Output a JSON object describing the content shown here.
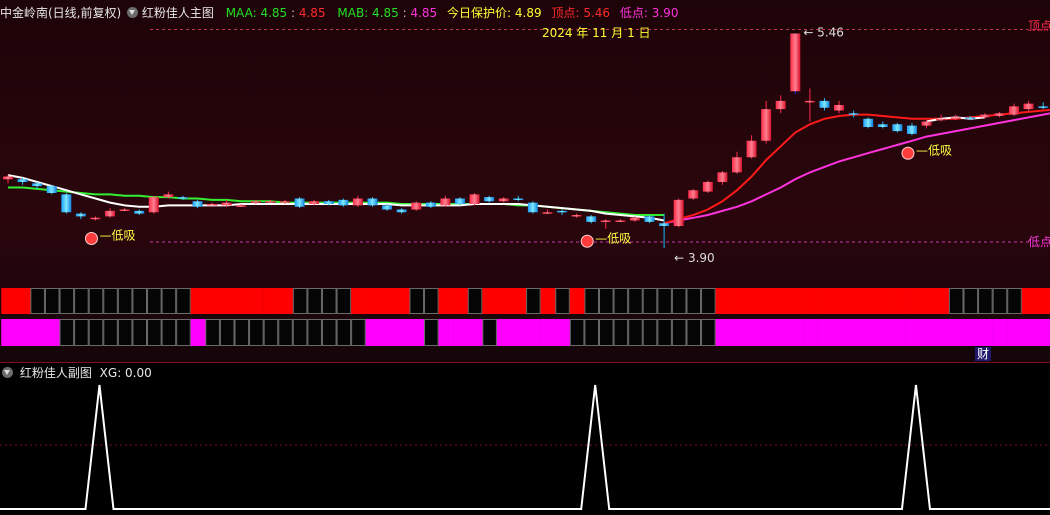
{
  "header": {
    "stock_name": "中金岭南(日线,前复权)",
    "indicator_name": "红粉佳人主图",
    "maa_label": "MAA: 4.85",
    "maa_value": "4.85",
    "mab_label": "MAB: 4.85",
    "mab_value": "4.85",
    "protect_label": "今日保护价:",
    "protect_value": "4.89",
    "top_label": "顶点:",
    "top_value": "5.46",
    "low_label": "低点:",
    "low_value": "3.90"
  },
  "date_label": "2024 年 11 月 1 日",
  "annotations": {
    "high_price": "5.46",
    "low_price": "3.90",
    "low_buy": "低吸",
    "right_low_tag": "低点",
    "right_top_tag": "顶点",
    "cai_tag": "财"
  },
  "sub_panel": {
    "title": "红粉佳人副图",
    "xg_label": "XG: 0.00"
  },
  "colors": {
    "up": "#ff2a4a",
    "down": "#17b8ff",
    "maa": "#ff1a1a",
    "mab": "#ff33dd",
    "ma_white": "#ffffff",
    "ma_green": "#33ee33",
    "band_red": "#ff0000",
    "band_magenta": "#ff00ff"
  },
  "chart_data": {
    "type": "candlestick",
    "price_range": [
      3.74,
      5.5
    ],
    "top_price": 5.46,
    "low_price": 3.9,
    "candles": [
      [
        4.4,
        4.42,
        4.37,
        4.43
      ],
      [
        4.4,
        4.38,
        4.36,
        4.41
      ],
      [
        4.37,
        4.35,
        4.33,
        4.38
      ],
      [
        4.35,
        4.3,
        4.29,
        4.36
      ],
      [
        4.29,
        4.16,
        4.15,
        4.3
      ],
      [
        4.15,
        4.13,
        4.11,
        4.16
      ],
      [
        4.12,
        4.12,
        4.1,
        4.13
      ],
      [
        4.13,
        4.17,
        4.12,
        4.19
      ],
      [
        4.18,
        4.18,
        4.17,
        4.19
      ],
      [
        4.17,
        4.15,
        4.14,
        4.18
      ],
      [
        4.16,
        4.27,
        4.15,
        4.28
      ],
      [
        4.27,
        4.29,
        4.26,
        4.31
      ],
      [
        4.27,
        4.26,
        4.25,
        4.28
      ],
      [
        4.24,
        4.2,
        4.19,
        4.25
      ],
      [
        4.22,
        4.22,
        4.21,
        4.23
      ],
      [
        4.21,
        4.23,
        4.2,
        4.25
      ],
      [
        4.21,
        4.21,
        4.2,
        4.22
      ],
      [
        4.23,
        4.24,
        4.22,
        4.25
      ],
      [
        4.24,
        4.24,
        4.23,
        4.25
      ],
      [
        4.23,
        4.24,
        4.22,
        4.25
      ],
      [
        4.26,
        4.2,
        4.19,
        4.27
      ],
      [
        4.22,
        4.24,
        4.21,
        4.25
      ],
      [
        4.24,
        4.22,
        4.21,
        4.25
      ],
      [
        4.25,
        4.21,
        4.2,
        4.26
      ],
      [
        4.21,
        4.26,
        4.2,
        4.28
      ],
      [
        4.26,
        4.21,
        4.2,
        4.27
      ],
      [
        4.21,
        4.18,
        4.17,
        4.22
      ],
      [
        4.18,
        4.16,
        4.15,
        4.19
      ],
      [
        4.18,
        4.23,
        4.17,
        4.24
      ],
      [
        4.23,
        4.2,
        4.19,
        4.24
      ],
      [
        4.21,
        4.26,
        4.2,
        4.28
      ],
      [
        4.26,
        4.22,
        4.21,
        4.27
      ],
      [
        4.22,
        4.29,
        4.21,
        4.3
      ],
      [
        4.27,
        4.24,
        4.23,
        4.28
      ],
      [
        4.24,
        4.26,
        4.23,
        4.27
      ],
      [
        4.26,
        4.25,
        4.24,
        4.28
      ],
      [
        4.23,
        4.16,
        4.15,
        4.24
      ],
      [
        4.16,
        4.16,
        4.15,
        4.18
      ],
      [
        4.17,
        4.16,
        4.14,
        4.18
      ],
      [
        4.14,
        4.14,
        4.12,
        4.15
      ],
      [
        4.13,
        4.09,
        4.08,
        4.14
      ],
      [
        4.09,
        4.1,
        4.04,
        4.11
      ],
      [
        4.1,
        4.1,
        4.09,
        4.11
      ],
      [
        4.1,
        4.12,
        4.09,
        4.13
      ],
      [
        4.13,
        4.09,
        4.08,
        4.14
      ],
      [
        4.08,
        4.06,
        3.9,
        4.15
      ],
      [
        4.06,
        4.25,
        4.05,
        4.26
      ],
      [
        4.26,
        4.32,
        4.25,
        4.33
      ],
      [
        4.31,
        4.38,
        4.3,
        4.39
      ],
      [
        4.38,
        4.45,
        4.36,
        4.46
      ],
      [
        4.45,
        4.56,
        4.44,
        4.6
      ],
      [
        4.56,
        4.68,
        4.55,
        4.72
      ],
      [
        4.68,
        4.91,
        4.66,
        4.97
      ],
      [
        4.91,
        4.97,
        4.88,
        5.01
      ],
      [
        5.04,
        5.46,
        5.02,
        5.46
      ],
      [
        4.96,
        4.97,
        4.82,
        5.06
      ],
      [
        4.97,
        4.92,
        4.9,
        4.99
      ],
      [
        4.9,
        4.94,
        4.88,
        4.97
      ],
      [
        4.88,
        4.87,
        4.85,
        4.9
      ],
      [
        4.84,
        4.78,
        4.77,
        4.85
      ],
      [
        4.8,
        4.78,
        4.77,
        4.82
      ],
      [
        4.8,
        4.75,
        4.74,
        4.81
      ],
      [
        4.79,
        4.73,
        4.72,
        4.81
      ],
      [
        4.79,
        4.82,
        4.77,
        4.83
      ],
      [
        4.83,
        4.84,
        4.82,
        4.87
      ],
      [
        4.85,
        4.85,
        4.83,
        4.87
      ],
      [
        4.85,
        4.84,
        4.83,
        4.86
      ],
      [
        4.85,
        4.87,
        4.84,
        4.88
      ],
      [
        4.86,
        4.88,
        4.85,
        4.89
      ],
      [
        4.87,
        4.93,
        4.86,
        4.95
      ],
      [
        4.91,
        4.95,
        4.89,
        4.97
      ],
      [
        4.93,
        4.92,
        4.91,
        4.96
      ],
      [
        4.91,
        4.93,
        4.9,
        4.94
      ],
      [
        4.92,
        4.98,
        4.91,
        5.05
      ]
    ],
    "maa": [
      null,
      null,
      null,
      null,
      null,
      null,
      null,
      null,
      null,
      null,
      null,
      null,
      null,
      null,
      null,
      null,
      null,
      null,
      null,
      null,
      null,
      null,
      null,
      null,
      null,
      null,
      null,
      null,
      null,
      null,
      null,
      null,
      null,
      null,
      null,
      null,
      null,
      null,
      null,
      null,
      null,
      null,
      null,
      null,
      null,
      4.08,
      4.11,
      4.14,
      4.18,
      4.24,
      4.32,
      4.42,
      4.54,
      4.64,
      4.74,
      4.8,
      4.84,
      4.86,
      4.87,
      4.87,
      4.86,
      4.85,
      4.84,
      4.84,
      4.84,
      4.84,
      4.85,
      4.86,
      4.87,
      4.88,
      4.89,
      4.9,
      4.91,
      4.92
    ],
    "mab": [
      null,
      null,
      null,
      null,
      null,
      null,
      null,
      null,
      null,
      null,
      null,
      null,
      null,
      null,
      null,
      null,
      null,
      null,
      null,
      null,
      null,
      null,
      null,
      null,
      null,
      null,
      null,
      null,
      null,
      null,
      null,
      null,
      null,
      null,
      null,
      null,
      null,
      null,
      null,
      null,
      null,
      null,
      null,
      null,
      null,
      4.08,
      4.1,
      4.12,
      4.14,
      4.17,
      4.2,
      4.24,
      4.29,
      4.34,
      4.4,
      4.45,
      4.49,
      4.53,
      4.56,
      4.59,
      4.62,
      4.65,
      4.68,
      4.71,
      4.73,
      4.75,
      4.77,
      4.79,
      4.81,
      4.83,
      4.85,
      4.87,
      4.89,
      4.91
    ],
    "ma_white": [
      4.43,
      4.41,
      4.38,
      4.35,
      4.32,
      4.29,
      4.26,
      4.23,
      4.21,
      4.2,
      4.2,
      4.21,
      4.21,
      4.21,
      4.21,
      4.21,
      4.22,
      4.22,
      4.22,
      4.22,
      4.22,
      4.22,
      4.22,
      4.22,
      4.22,
      4.22,
      4.22,
      4.21,
      4.21,
      4.21,
      4.21,
      4.21,
      4.22,
      4.22,
      4.22,
      4.22,
      4.21,
      4.2,
      4.19,
      4.18,
      4.17,
      4.15,
      4.14,
      4.13,
      4.12,
      4.1
    ],
    "ma_green": [
      4.34,
      4.34,
      4.33,
      4.32,
      4.31,
      4.3,
      4.29,
      4.29,
      4.28,
      4.28,
      4.27,
      4.27,
      4.26,
      4.26,
      4.25,
      4.25,
      4.24,
      4.24,
      4.24,
      4.23,
      4.23,
      4.23,
      4.23,
      4.23,
      4.23,
      4.23,
      4.23,
      4.22,
      4.22,
      4.22,
      4.22,
      4.22,
      4.22,
      4.22,
      4.22,
      4.21,
      4.21,
      4.2,
      4.19,
      4.18,
      4.17,
      4.16,
      4.15,
      4.14,
      4.14,
      4.14
    ],
    "mab_late": [
      null,
      null,
      null,
      null,
      null,
      null,
      null,
      null,
      null,
      null,
      null,
      null,
      null,
      null,
      null,
      null,
      null,
      null,
      null,
      null,
      null,
      null,
      null,
      null,
      null,
      null,
      null,
      null,
      null,
      null,
      null,
      null,
      null,
      null,
      null,
      null,
      null,
      null,
      null,
      null,
      null,
      null,
      null,
      null,
      null,
      null,
      null,
      null,
      null,
      null,
      null,
      null,
      null,
      null,
      null,
      null,
      null,
      null,
      null,
      null,
      null,
      null,
      null,
      null,
      null,
      4.82,
      4.83,
      4.85,
      4.86,
      4.87,
      4.88,
      4.89,
      4.9,
      4.91
    ],
    "white_late": [
      null,
      null,
      null,
      null,
      null,
      null,
      null,
      null,
      null,
      null,
      null,
      null,
      null,
      null,
      null,
      null,
      null,
      null,
      null,
      null,
      null,
      null,
      null,
      null,
      null,
      null,
      null,
      null,
      null,
      null,
      null,
      null,
      null,
      null,
      null,
      null,
      null,
      null,
      null,
      null,
      null,
      null,
      null,
      null,
      null,
      null,
      null,
      null,
      null,
      null,
      null,
      null,
      null,
      null,
      null,
      null,
      null,
      null,
      null,
      null,
      null,
      null,
      null,
      4.82,
      4.84,
      4.85,
      4.84,
      4.85
    ],
    "band_red": [
      1,
      1,
      0,
      0,
      0,
      0,
      0,
      0,
      0,
      0,
      0,
      0,
      0,
      1,
      1,
      1,
      1,
      1,
      1,
      1,
      0,
      0,
      0,
      0,
      1,
      1,
      1,
      1,
      0,
      0,
      1,
      1,
      0,
      1,
      1,
      1,
      0,
      1,
      0,
      1,
      0,
      0,
      0,
      0,
      0,
      0,
      0,
      0,
      0,
      1,
      1,
      1,
      1,
      1,
      1,
      1,
      1,
      1,
      1,
      1,
      1,
      1,
      1,
      1,
      1,
      0,
      0,
      0,
      0,
      0,
      1,
      1,
      1,
      1
    ],
    "band_magenta": [
      1,
      1,
      1,
      1,
      0,
      0,
      0,
      0,
      0,
      0,
      0,
      0,
      0,
      1,
      0,
      0,
      0,
      0,
      0,
      0,
      0,
      0,
      0,
      0,
      0,
      1,
      1,
      1,
      1,
      0,
      1,
      1,
      1,
      0,
      1,
      1,
      1,
      1,
      1,
      0,
      0,
      0,
      0,
      0,
      0,
      0,
      0,
      0,
      0,
      1,
      1,
      1,
      1,
      1,
      1,
      1,
      1,
      1,
      1,
      1,
      1,
      1,
      1,
      1,
      1,
      1,
      1,
      1,
      1,
      1,
      1,
      1,
      1,
      1
    ],
    "xg_signals": [
      6,
      40,
      62
    ],
    "low_buy_marks": [
      6,
      40,
      62
    ]
  }
}
